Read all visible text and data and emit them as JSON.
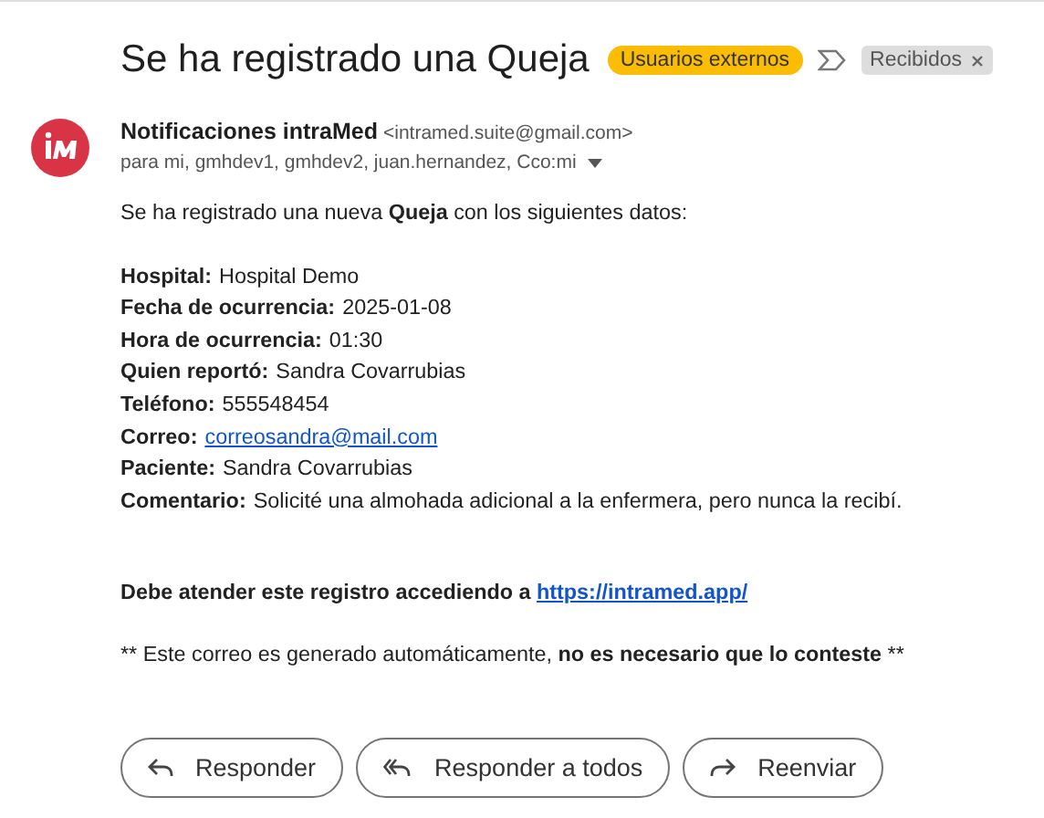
{
  "subject": "Se ha registrado una Queja",
  "labels": [
    {
      "text": "Usuarios externos",
      "kind": "category",
      "color": "#fbbc04"
    },
    {
      "text": "Recibidos",
      "kind": "folder",
      "removable": true
    }
  ],
  "sender": {
    "name": "Notificaciones intraMed",
    "email": "<intramed.suite@gmail.com>",
    "recipients": "para mi, gmhdev1, gmhdev2, juan.hernandez, Cco:mi"
  },
  "intro": "Se ha registrado una nueva **Queja** con los siguientes datos:",
  "fields": [
    {
      "label": "Hospital:",
      "value": "Hospital Demo",
      "kind": "text"
    },
    {
      "label": "Fecha de ocurrencia:",
      "value": "2025-01-08",
      "kind": "text"
    },
    {
      "label": "Hora de ocurrencia:",
      "value": "01:30",
      "kind": "text"
    },
    {
      "label": "Quien reportó:",
      "value": "Sandra Covarrubias",
      "kind": "text"
    },
    {
      "label": "Teléfono:",
      "value": "555548454",
      "kind": "text"
    },
    {
      "label": "Correo:",
      "value": "correosandra@mail.com",
      "kind": "link"
    },
    {
      "label": "Paciente:",
      "value": "Sandra Covarrubias",
      "kind": "text"
    },
    {
      "label": "Comentario:",
      "value": "Solicité una almohada adicional a la enfermera, pero nunca la recibí.",
      "kind": "text"
    }
  ],
  "action": {
    "text": "Debe atender este registro accediendo a",
    "link": "https://intramed.app/"
  },
  "footer": [
    {
      "text": "** Este correo es generado automáticamente, ",
      "bold": false
    },
    {
      "text": "no es necesario que lo conteste",
      "bold": true
    },
    {
      "text": " **",
      "bold": false
    }
  ],
  "buttons": [
    {
      "label": "Responder",
      "kind": "reply"
    },
    {
      "label": "Responder a todos",
      "kind": "reply-all"
    },
    {
      "label": "Reenviar",
      "kind": "forward"
    }
  ]
}
